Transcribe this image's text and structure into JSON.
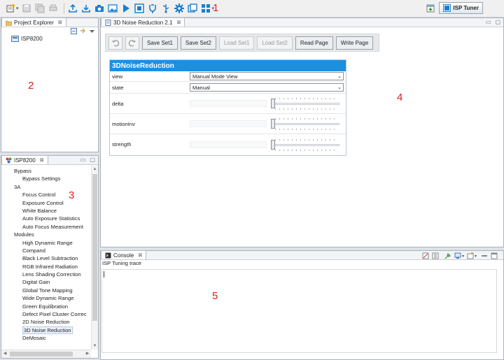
{
  "toolbar": {
    "icons": [
      "new-icon",
      "save-icon",
      "save-all-icon",
      "print-icon",
      "upload-icon",
      "download-icon",
      "camera-icon",
      "image-icon",
      "play-icon",
      "stop-icon",
      "connect-icon",
      "usb-icon",
      "settings-icon",
      "windows-icon",
      "grid-icon"
    ],
    "perspective_label": "ISP Tuner"
  },
  "annotations": [
    "1",
    "2",
    "3",
    "4",
    "5"
  ],
  "project_explorer": {
    "tab_label": "Project Explorer",
    "items": [
      {
        "label": "ISP8200"
      }
    ]
  },
  "isp_tree": {
    "tab_label": "ISP8200",
    "items": [
      {
        "label": "Bypass",
        "level": 0
      },
      {
        "label": "Bypass Settings",
        "level": 1
      },
      {
        "label": "3A",
        "level": 0
      },
      {
        "label": "Focus Control",
        "level": 1
      },
      {
        "label": "Exposure Control",
        "level": 1
      },
      {
        "label": "White Balance",
        "level": 1
      },
      {
        "label": "Auto Exposure Statistics",
        "level": 1
      },
      {
        "label": "Auto Focus Measurement",
        "level": 1
      },
      {
        "label": "Modules",
        "level": 0
      },
      {
        "label": "High Dynamic Range",
        "level": 1
      },
      {
        "label": "Compand",
        "level": 1
      },
      {
        "label": "Black Level Subtraction",
        "level": 1
      },
      {
        "label": "RGB Infrared Radiation",
        "level": 1
      },
      {
        "label": "Lens Shading Correction",
        "level": 1
      },
      {
        "label": "Digital Gain",
        "level": 1
      },
      {
        "label": "Global Tone Mapping",
        "level": 1
      },
      {
        "label": "Wide Dynamic Range",
        "level": 1
      },
      {
        "label": "Green Equilibration",
        "level": 1
      },
      {
        "label": "Defect Pixel Cluster Correc",
        "level": 1
      },
      {
        "label": "2D Noise Reduction",
        "level": 1
      },
      {
        "label": "3D Noise Reduction",
        "level": 1,
        "selected": true
      },
      {
        "label": "DeMosaic",
        "level": 1
      }
    ]
  },
  "editor": {
    "tab_label": "3D Noise Reduction 2.1",
    "buttons": {
      "save_set1": "Save Set1",
      "save_set2": "Save Set2",
      "load_set1": "Load Set1",
      "load_set2": "Load Set2",
      "read_page": "Read Page",
      "write_page": "Write Page"
    },
    "panel_title": "3DNoiseReduction",
    "params": {
      "view": {
        "label": "view",
        "value": "Manual Mode View"
      },
      "state": {
        "label": "state",
        "value": "Manual"
      },
      "delta": {
        "label": "delta",
        "value": "",
        "slider": 0
      },
      "motionInv": {
        "label": "motionInv",
        "value": "",
        "slider": 0
      },
      "strength": {
        "label": "strength",
        "value": "",
        "slider": 0
      }
    }
  },
  "console": {
    "tab_label": "Console",
    "trace_label": "ISP Tuning trace"
  },
  "colors": {
    "panel_header": "#1d8fe0",
    "annotation": "#e02020",
    "accent_icon": "#1a7fd0"
  }
}
